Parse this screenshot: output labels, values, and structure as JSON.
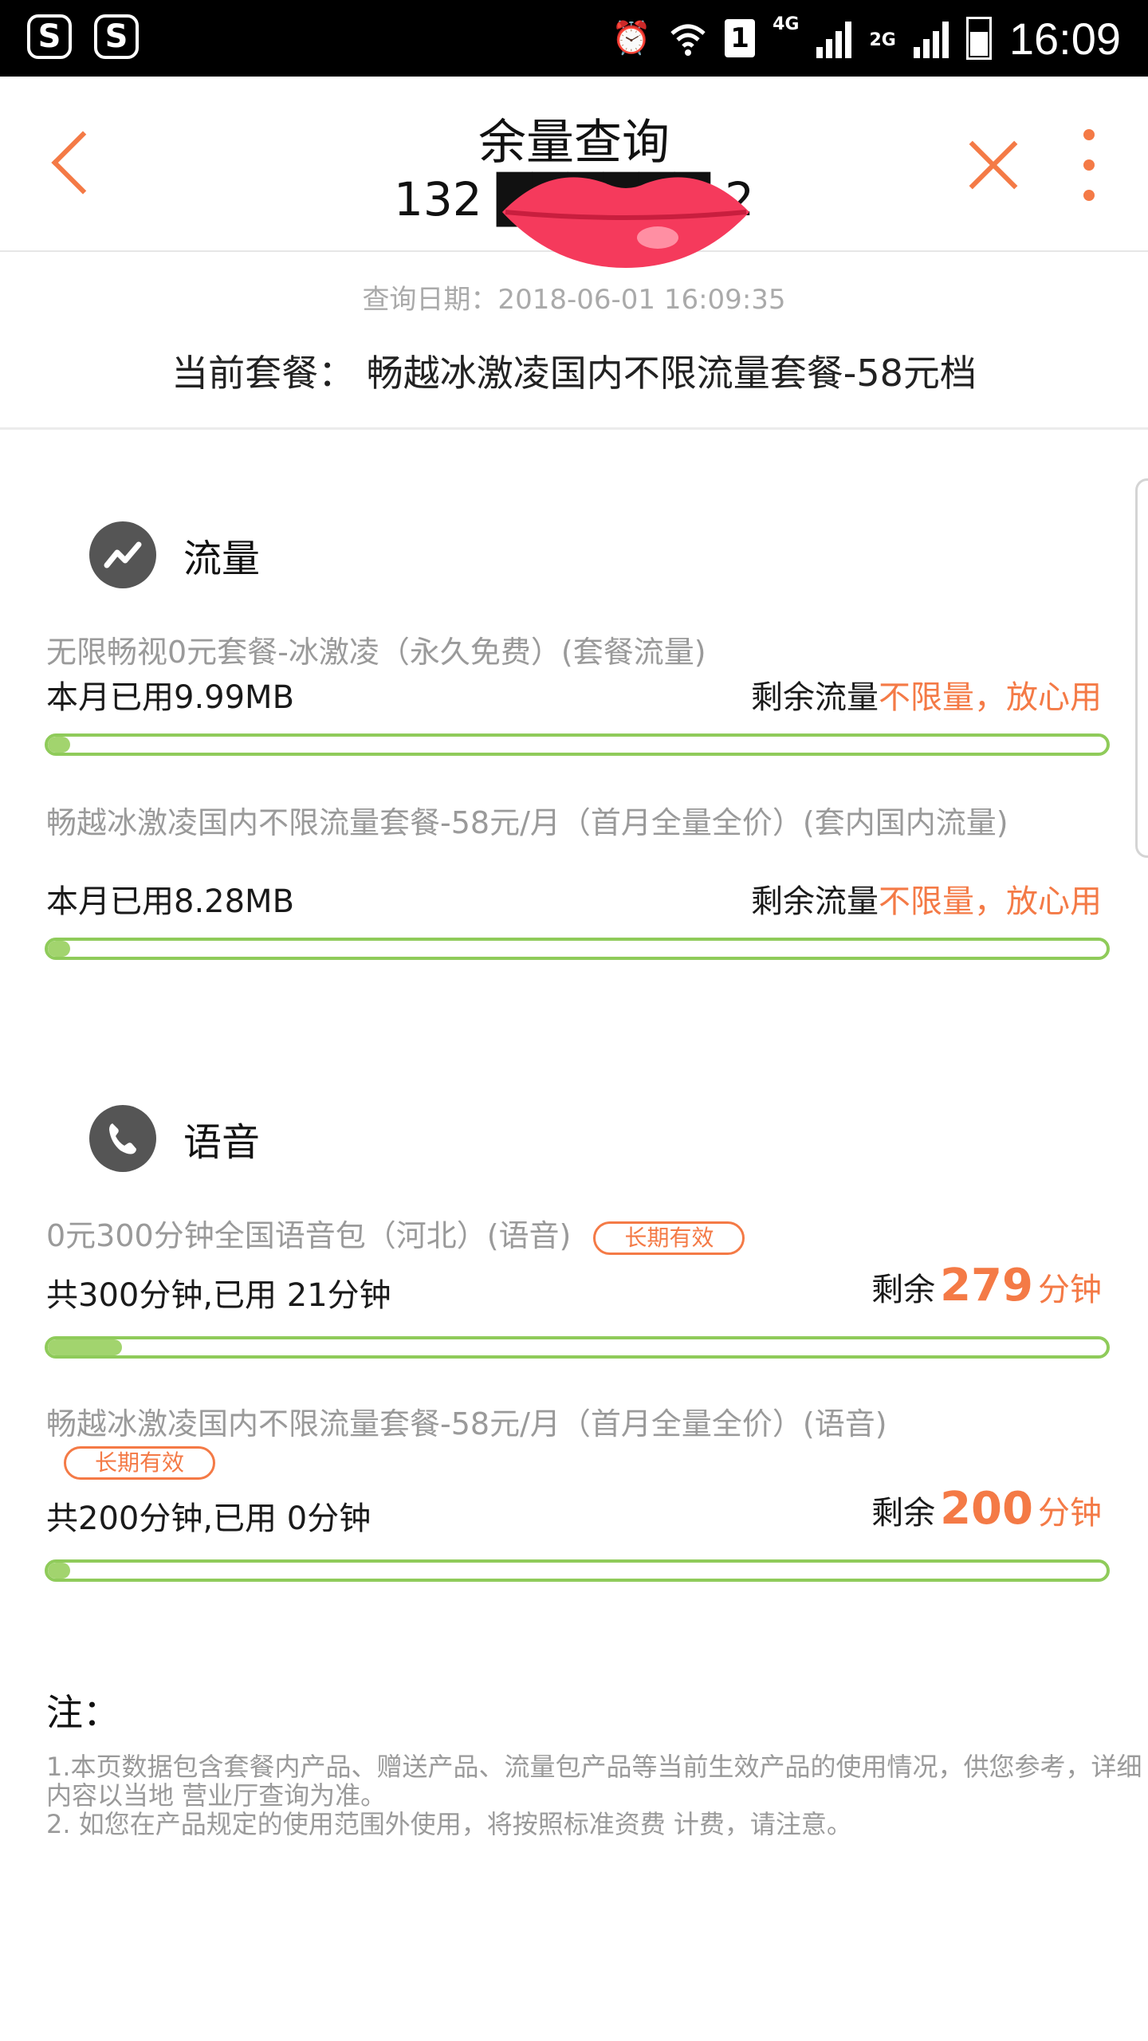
{
  "status_bar": {
    "time": "16:09",
    "sim_slot": "1",
    "network_primary": "4G",
    "network_secondary": "2G",
    "icons": [
      "sogou-icon",
      "sogou-s-icon",
      "alarm-icon",
      "wifi-icon",
      "signal-icon",
      "battery-icon"
    ]
  },
  "header": {
    "title": "余量查询",
    "phone_number": "132 ██████ 2",
    "back_icon": "chevron-left-icon",
    "close_icon": "close-icon",
    "more_icon": "more-vertical-icon",
    "accent_color": "#f47a46"
  },
  "info": {
    "query_date": "查询日期：2018-06-01 16:09:35",
    "current_plan": "当前套餐： 畅越冰激凌国内不限流量套餐-58元档"
  },
  "data_section": {
    "title": "流量",
    "icon": "trend-line-icon",
    "items": [
      {
        "name": "无限畅视0元套餐-冰激凌（永久免费）(套餐流量)",
        "used": "本月已用9.99MB",
        "remain_label": "剩余流量",
        "remain_value": "不限量，放心用",
        "progress": 0.01
      },
      {
        "name": "畅越冰激凌国内不限流量套餐-58元/月（首月全量全价）(套内国内流量)",
        "used": "本月已用8.28MB",
        "remain_label": "剩余流量",
        "remain_value": "不限量，放心用",
        "progress": 0.01
      }
    ]
  },
  "voice_section": {
    "title": "语音",
    "icon": "phone-icon",
    "items": [
      {
        "name": "0元300分钟全国语音包（河北）(语音)",
        "badge": "长期有效",
        "used": "共300分钟,已用 21分钟",
        "remain_label": "剩余",
        "remain_number": "279",
        "remain_unit": "分钟",
        "progress": 0.07
      },
      {
        "name": "畅越冰激凌国内不限流量套餐-58元/月（首月全量全价）(语音)",
        "badge": "长期有效",
        "used": "共200分钟,已用 0分钟",
        "remain_label": "剩余",
        "remain_number": "200",
        "remain_unit": "分钟",
        "progress": 0.0
      }
    ]
  },
  "notes": {
    "title": "注：",
    "line1": "1.本页数据包含套餐内产品、赠送产品、流量包产品等当前生效产品的使用情况，供您参考，详细内容以当地 营业厅查询为准。",
    "line2": "2. 如您在产品规定的使用范围外使用，将按照标准资费 计费，请注意。"
  }
}
